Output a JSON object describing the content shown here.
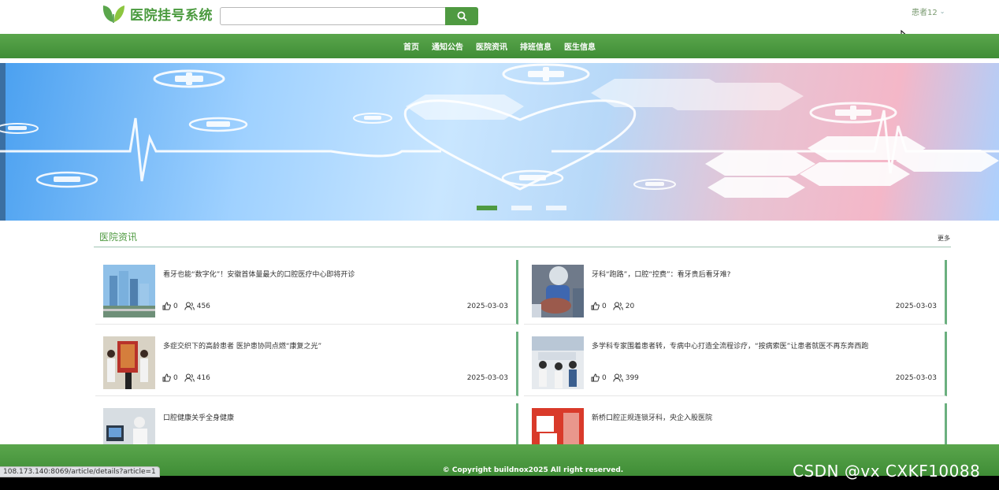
{
  "header": {
    "site_title": "医院挂号系统",
    "search": {
      "value": "",
      "placeholder": ""
    },
    "user_label": "患者12"
  },
  "nav": {
    "items": [
      {
        "label": "首页"
      },
      {
        "label": "通知公告"
      },
      {
        "label": "医院资讯"
      },
      {
        "label": "排班信息"
      },
      {
        "label": "医生信息"
      }
    ]
  },
  "banner": {
    "slide_count": 3,
    "active_slide": 1
  },
  "news": {
    "section_title": "医院资讯",
    "more_label": "更多",
    "items": [
      {
        "title": "看牙也能“数字化”！安徽首体量最大的口腔医疗中心即将开诊",
        "likes": "0",
        "views": "456",
        "date": "2025-03-03"
      },
      {
        "title": "牙科“跑路”，口腔“控费”：看牙贵后看牙难?",
        "likes": "0",
        "views": "20",
        "date": "2025-03-03"
      },
      {
        "title": "多症交织下的高龄患者 医护患协同点燃“康复之光”",
        "likes": "0",
        "views": "416",
        "date": "2025-03-03"
      },
      {
        "title": "多学科专家围着患者转，专病中心打造全流程诊疗，“按病索医”让患者就医不再东奔西跑",
        "likes": "0",
        "views": "399",
        "date": "2025-03-03"
      },
      {
        "title": "口腔健康关乎全身健康",
        "likes": "",
        "views": "",
        "date": ""
      },
      {
        "title": "新桥口腔正规连锁牙科，央企入股医院",
        "likes": "",
        "views": "",
        "date": ""
      }
    ]
  },
  "footer": {
    "copyright": "© Copyright buildnox2025   All right reserved."
  },
  "browser": {
    "status_url": "108.173.140:8069/article/details?article=1",
    "watermark": "CSDN @vx  CXKF10088"
  },
  "colors": {
    "brand_green": "#4f9a41",
    "card_accent": "#6bb07f"
  }
}
